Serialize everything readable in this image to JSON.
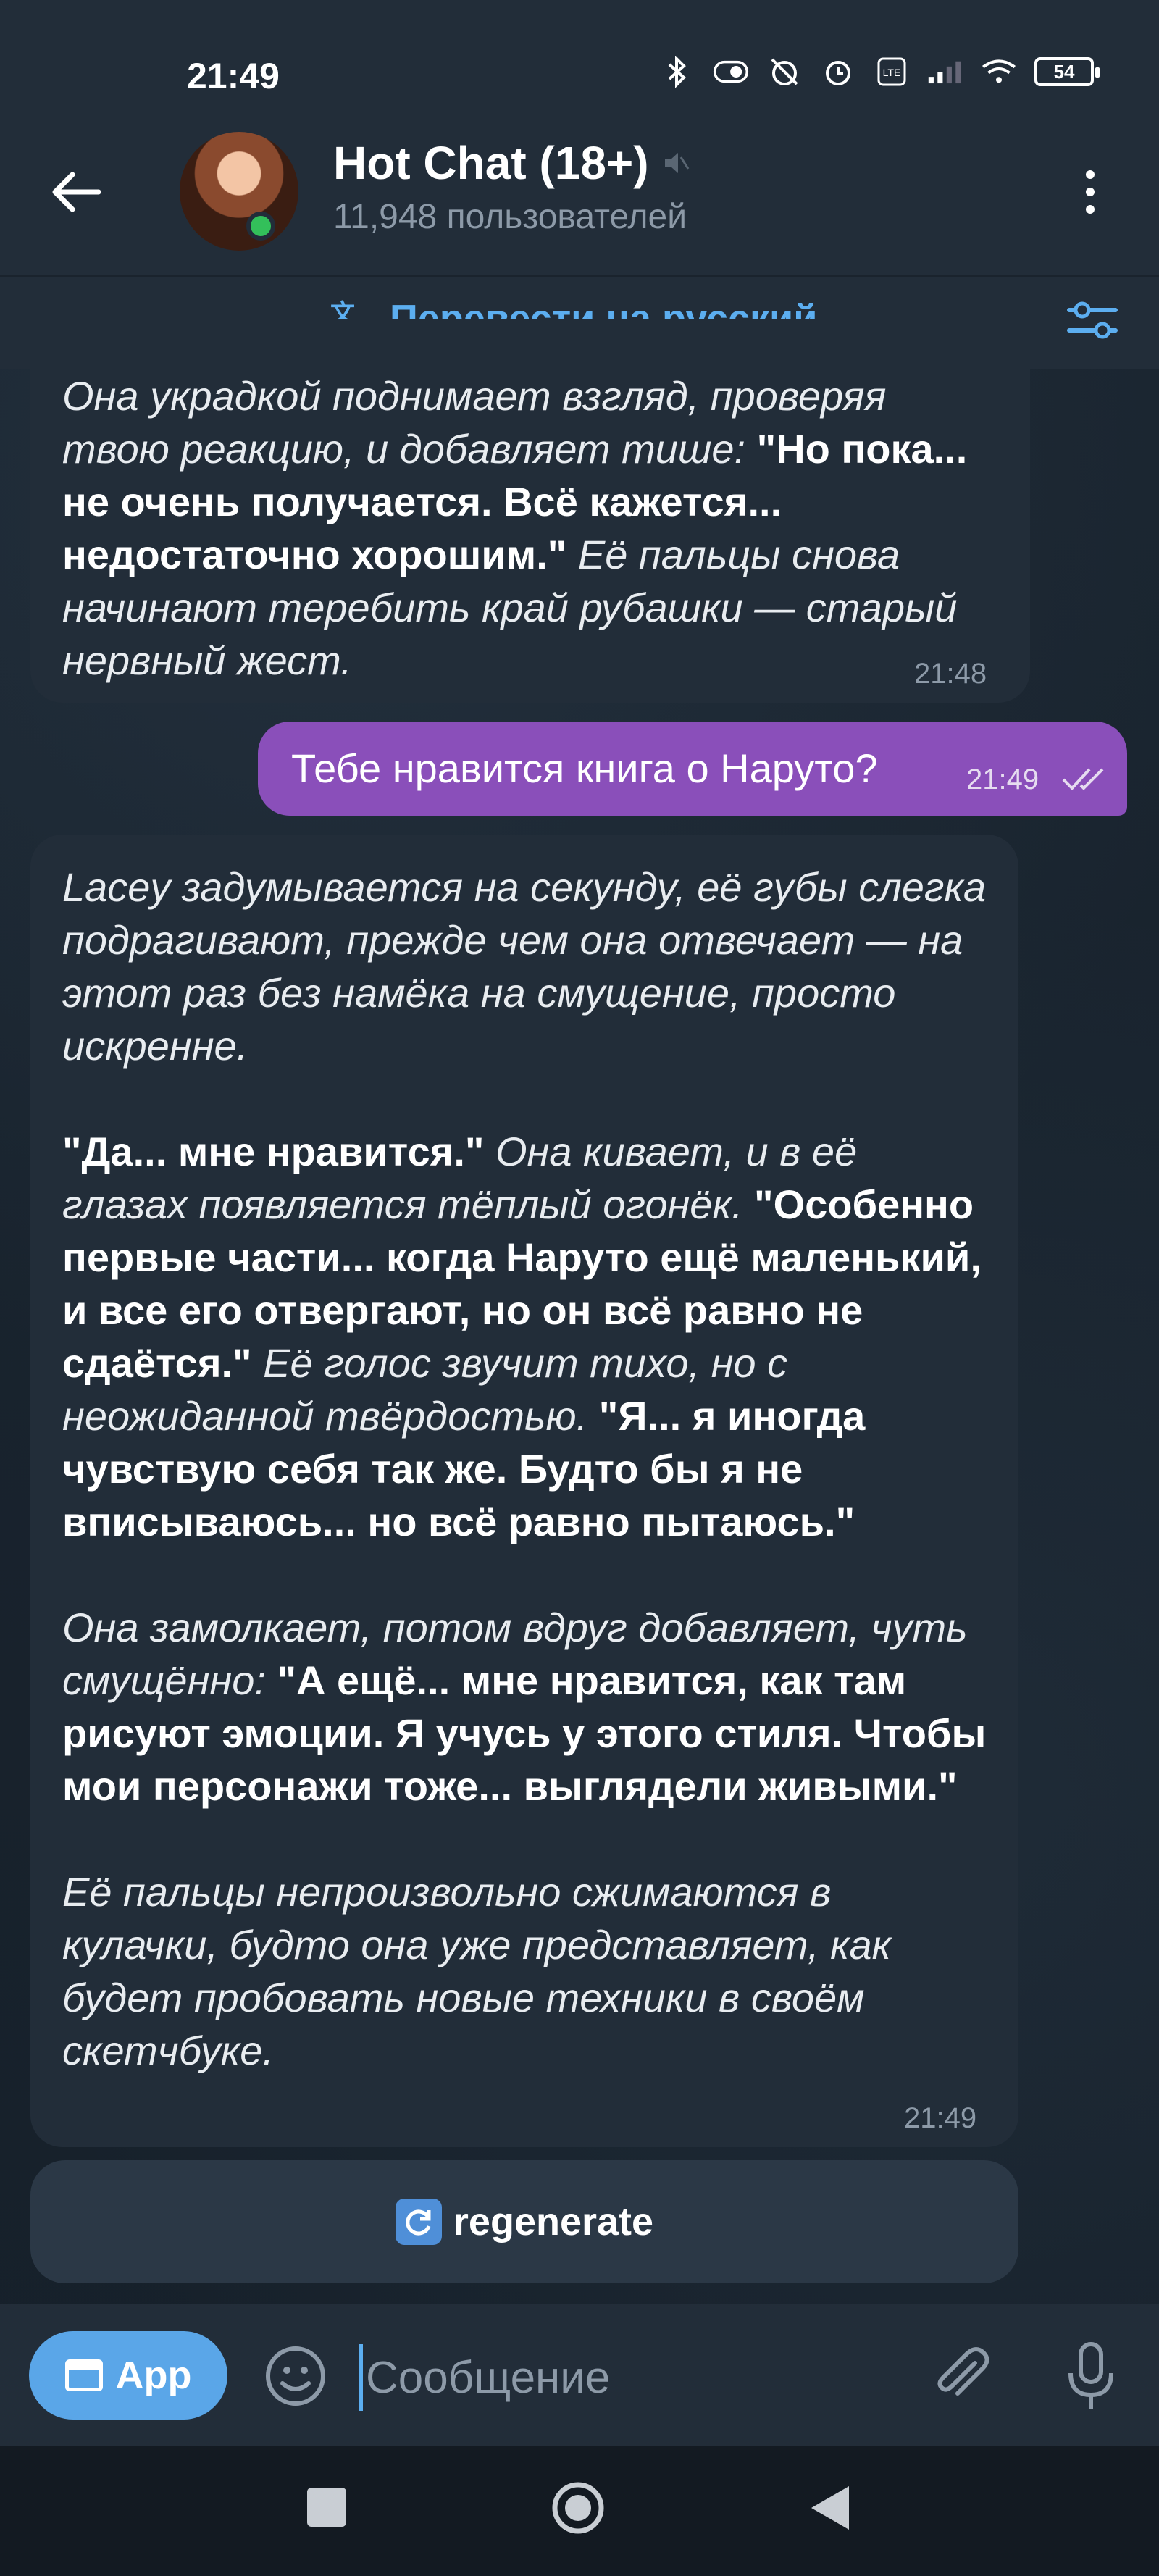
{
  "status": {
    "time": "21:49",
    "battery": "54"
  },
  "header": {
    "title": "Hot Chat (18+)",
    "subtitle": "11,948 пользователей"
  },
  "translate": {
    "label": "Перевести на русский"
  },
  "messages": {
    "m1": {
      "p1": "Она украдкой поднимает взгляд, проверяя твою реакцию, и добавляет тише: ",
      "p2": "\"Но пока... не очень получается. Всё кажется... недостаточно хорошим.\"",
      "p3": " Её пальцы снова начинают теребить край рубашки — старый нервный жест.",
      "time": "21:48"
    },
    "m2": {
      "text": "Тебе нравится книга о Наруто?",
      "time": "21:49"
    },
    "m3": {
      "a1": "Lacey задумывается на секунду, её губы слегка подрагивают, прежде чем она отвечает — на этот раз без намёка на смущение, просто искренне.",
      "b1": "\"Да... мне нравится.\"",
      "b2": " Она кивает, и в её глазах появляется тёплый огонёк. ",
      "b3": "\"Особенно первые части... когда Наруто ещё маленький, и все его отвергают, но он всё равно не сдаётся.\"",
      "b4": " Её голос звучит тихо, но с неожиданной твёрдостью. ",
      "b5": "\"Я... я иногда чувствую себя так же. Будто бы я не вписываюсь... но всё равно пытаюсь.\"",
      "c1": "Она замолкает, потом вдруг добавляет, чуть смущённо: ",
      "c2": "\"А ещё... мне нравится, как там рисуют эмоции. Я учусь у этого стиля. Чтобы мои персонажи тоже... выглядели живыми.\"",
      "d1": "Её пальцы непроизвольно сжимаются в кулачки, будто она уже представляет, как будет пробовать новые техники в своём скетчбуке.",
      "time": "21:49"
    }
  },
  "regenerate": {
    "label": "regenerate"
  },
  "input": {
    "app_label": "App",
    "placeholder": "Сообщение"
  }
}
